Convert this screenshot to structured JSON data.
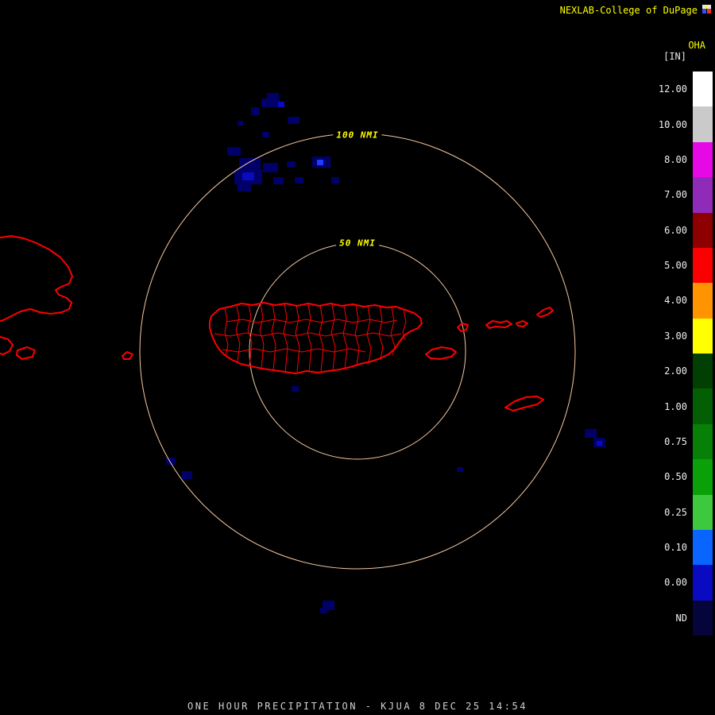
{
  "attribution": {
    "text": "NEXLAB-College of DuPage",
    "logo_icon": "nexlab-logo-icon",
    "color": "#ffff00"
  },
  "legend": {
    "product_code": "OHA",
    "units": "[IN]",
    "entries": [
      {
        "label": "12.00",
        "color": "#ffffff"
      },
      {
        "label": "10.00",
        "color": "#cacaca"
      },
      {
        "label": "8.00",
        "color": "#e609e6"
      },
      {
        "label": "7.00",
        "color": "#8f2bb8"
      },
      {
        "label": "6.00",
        "color": "#8e0000"
      },
      {
        "label": "5.00",
        "color": "#fb0000"
      },
      {
        "label": "4.00",
        "color": "#ff9400"
      },
      {
        "label": "3.00",
        "color": "#ffff00"
      },
      {
        "label": "2.00",
        "color": "#023f02"
      },
      {
        "label": "1.00",
        "color": "#045f04"
      },
      {
        "label": "0.75",
        "color": "#068006"
      },
      {
        "label": "0.50",
        "color": "#0aa00a"
      },
      {
        "label": "0.25",
        "color": "#3ec83e"
      },
      {
        "label": "0.10",
        "color": "#0a64ff"
      },
      {
        "label": "0.00",
        "color": "#0a0ac0"
      },
      {
        "label": "ND",
        "color": "#05053c"
      }
    ]
  },
  "radar": {
    "range_rings": [
      {
        "label": "100 NMI"
      },
      {
        "label": "50 NMI"
      }
    ],
    "ring_color": "#f6c9a2",
    "coastline_color": "#ff0000",
    "echo_colors": {
      "trace": "#000068",
      "light": "#0a0ac0",
      "moderate": "#1e3cff"
    }
  },
  "footer": {
    "caption": "ONE HOUR PRECIPITATION - KJUA 8 DEC 25 14:54"
  }
}
